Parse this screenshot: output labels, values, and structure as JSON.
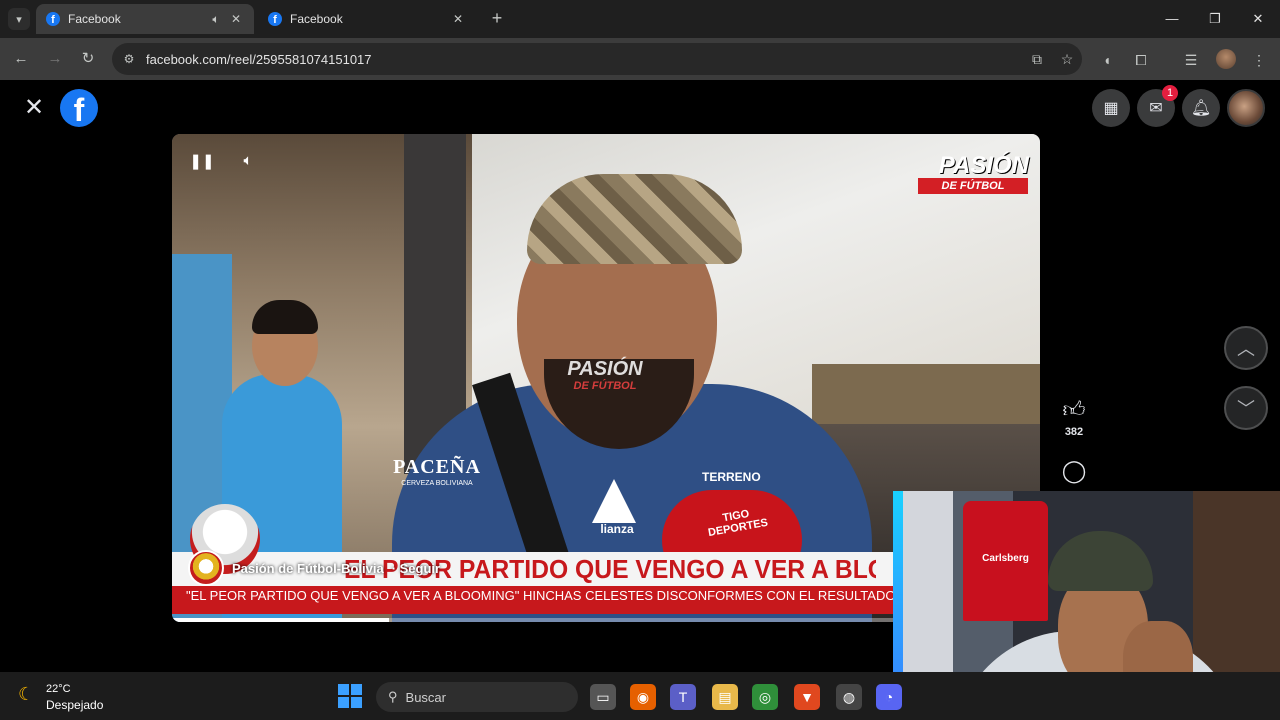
{
  "browser": {
    "tabs": [
      {
        "title": "Facebook",
        "active": true,
        "audio_icon": "speaker-icon"
      },
      {
        "title": "Facebook",
        "active": false
      }
    ],
    "url": "facebook.com/reel/2595581074151017"
  },
  "facebook": {
    "notification_badge": "1"
  },
  "video": {
    "brand_top": "PASIÓN",
    "brand_top_sub": "DE FÚTBOL",
    "watermark": "PASIÓN",
    "watermark_sub": "DE FÚTBOL",
    "shirt_brand": "PACEÑA",
    "shirt_sub": "CERVEZA BOLIVIANA",
    "shirt_logo_text": "lianza",
    "shirt_sponsor": "TERRENO",
    "mic_text": "TIGO DEPORTES",
    "headline": "EL PEOR PARTIDO QUE VENGO A VER A BLOOMI",
    "subheadline": "\"EL PEOR PARTIDO QUE VENGO A VER A BLOOMING\" HINCHAS CELESTES DISCONFORMES CON EL RESULTADO\"",
    "author": "Pasión de Fútbol-Bolivia",
    "follow_label": "· Seguir",
    "progress": 0.25
  },
  "rail": {
    "like_count": "382"
  },
  "webcam": {
    "jersey_text": "Carlsberg"
  },
  "taskbar": {
    "temperature": "22°C",
    "condition": "Despejado",
    "search_label": "Buscar"
  }
}
